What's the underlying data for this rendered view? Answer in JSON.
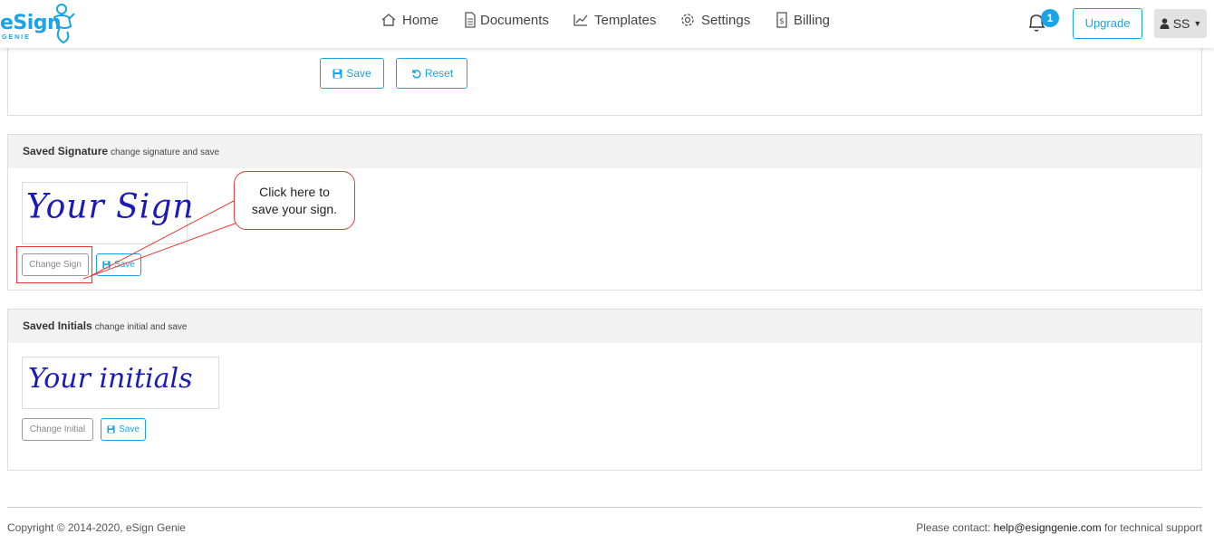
{
  "brand": {
    "name": "eSign",
    "sub": "GENIE"
  },
  "nav": {
    "home": "Home",
    "documents": "Documents",
    "templates": "Templates",
    "settings": "Settings",
    "billing": "Billing"
  },
  "notifications": {
    "count": "1"
  },
  "header": {
    "upgrade": "Upgrade",
    "user": "SS"
  },
  "top_panel": {
    "save": "Save",
    "reset": "Reset"
  },
  "signature": {
    "title": "Saved Signature",
    "hint": "change signature and save",
    "sample": "Your Sign",
    "change": "Change Sign",
    "save": "Save"
  },
  "initials": {
    "title": "Saved Initials",
    "hint": "change initial and save",
    "sample": "Your initials",
    "change": "Change Initial",
    "save": "Save"
  },
  "callout": {
    "line1": "Click here to",
    "line2": "save your sign."
  },
  "footer": {
    "copyright": "Copyright © 2014-2020, eSign Genie",
    "contact_prefix": "Please contact:",
    "email": "help@esigngenie.com",
    "contact_suffix": "for technical support"
  },
  "colors": {
    "accent": "#1aa3e8",
    "signature_ink": "#1a1ab8",
    "callout_border": "#e53935"
  }
}
